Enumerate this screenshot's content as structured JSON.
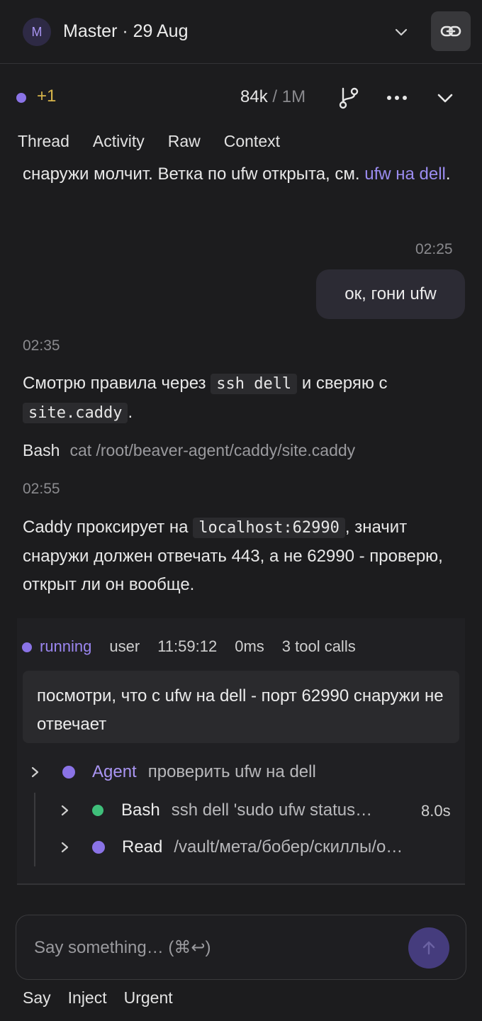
{
  "header": {
    "avatar_letter": "M",
    "title": "Master · 29 Aug",
    "icons": {
      "dropdown": "chevron-down-icon",
      "link": "link-icon"
    }
  },
  "subheader": {
    "plus_count": "+1",
    "tokens_used": "84k",
    "tokens_sep": "/",
    "tokens_max": "1M",
    "icons": {
      "branch": "branch-icon",
      "more": "more-icon",
      "collapse": "chevron-down-icon"
    }
  },
  "tabs": [
    "Thread",
    "Activity",
    "Raw",
    "Context"
  ],
  "messages": {
    "m1_text_a": "снаружи молчит. Ветка по ufw открыта, см. ",
    "m1_link": "ufw на dell",
    "m1_text_b": ".",
    "user_time": "02:25",
    "user_text": "ок, гони ufw",
    "m2_time": "02:35",
    "m2_text_a": "Смотрю правила через ",
    "m2_code_1": "ssh dell",
    "m2_text_b": " и сверяю с ",
    "m2_code_2": "site.caddy",
    "m2_text_c": ".",
    "tool_name": "Bash",
    "tool_arg": "cat /root/beaver-agent/caddy/site.caddy",
    "m3_time": "02:55",
    "m3_text_a": "Caddy проксирует на ",
    "m3_code": "localhost:62990",
    "m3_text_b": ", значит снаружи должен отвечать 443, а не 62990 - проверю, открыт ли он вообще."
  },
  "run": {
    "status": "running",
    "role": "user",
    "time": "11:59:12",
    "duration": "0ms",
    "tool_calls": "3 tool calls",
    "prompt": "посмотри, что с ufw на dell - порт 62990 снаружи не отвечает",
    "tree": [
      {
        "label": "Agent",
        "desc": "проверить ufw на dell",
        "dot_color": "#8a73e6"
      },
      {
        "label": "Bash",
        "desc": "ssh dell 'sudo ufw status…",
        "duration": "8.0s",
        "dot_color": "#3fbf7a"
      },
      {
        "label": "Read",
        "desc": "/vault/мета/бобер/скиллы/о…",
        "dot_color": "#8a73e6"
      }
    ]
  },
  "composer": {
    "placeholder": "Say something… (⌘↩)",
    "modes": [
      "Say",
      "Inject",
      "Urgent"
    ],
    "send_icon": "arrow-up-icon"
  },
  "colors": {
    "accent": "#8a73e6",
    "link": "#9b8cf0",
    "success": "#3fbf7a",
    "count": "#d6b44a"
  }
}
